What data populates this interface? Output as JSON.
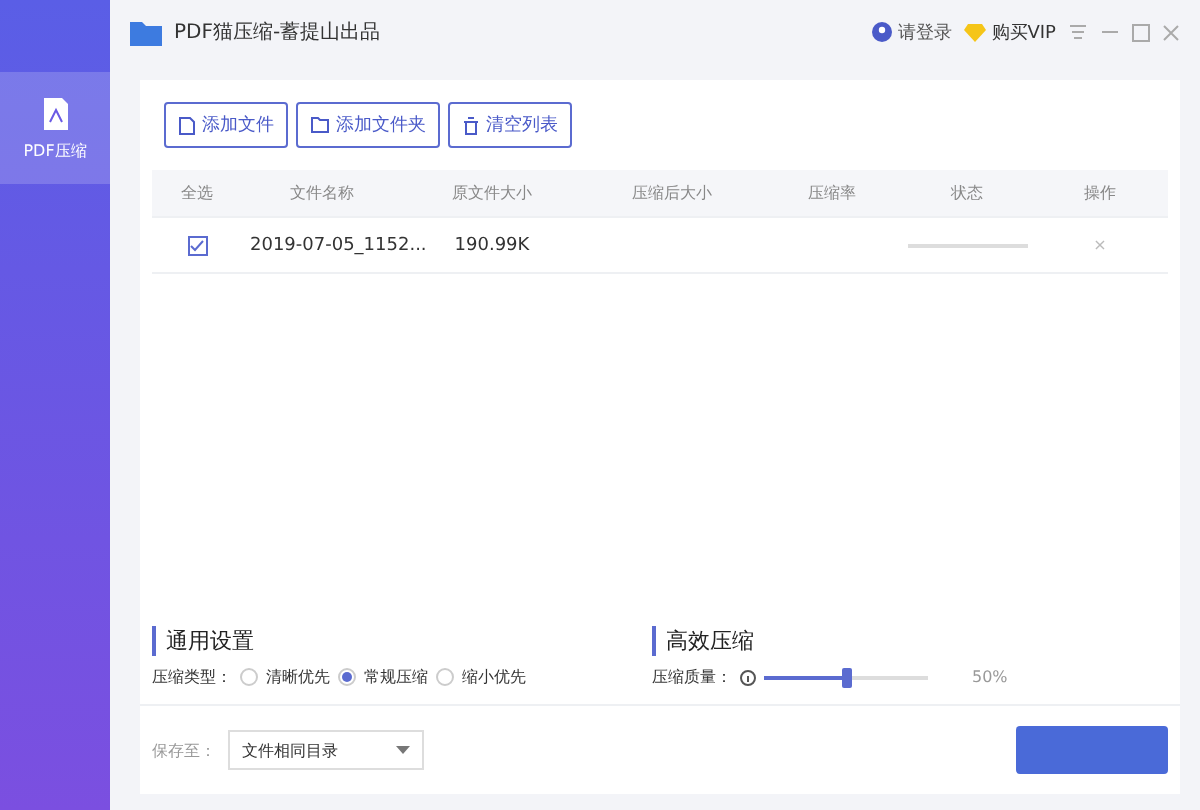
{
  "window": {
    "title": "PDF猫压缩-蓄提山出品",
    "login": "请登录",
    "vip": "购买VIP"
  },
  "sidebar": {
    "items": [
      {
        "label": "PDF压缩",
        "selected": true
      }
    ]
  },
  "toolbar": {
    "buttons": [
      {
        "label": "添加文件",
        "kind": "file"
      },
      {
        "label": "添加文件夹",
        "kind": "folder"
      },
      {
        "label": "清空列表",
        "kind": "clear"
      }
    ]
  },
  "table": {
    "columns": [
      "全选",
      "文件名称",
      "原文件大小",
      "压缩后大小",
      "压缩率",
      "状态",
      "操作"
    ],
    "rows": [
      {
        "checked": true,
        "name": "2019-07-05_1152...",
        "size": "190.99K",
        "level": 0,
        "action": "×"
      }
    ]
  },
  "settings": {
    "general": {
      "title": "通用设置",
      "type_label": "压缩类型：",
      "options": [
        {
          "label": "清晰优先",
          "selected": false
        },
        {
          "label": "常规压缩",
          "selected": true
        },
        {
          "label": "缩小优先",
          "selected": false
        }
      ]
    },
    "efficient": {
      "title": "高效压缩",
      "quality_label": "压缩质量：",
      "level": 0.5,
      "reading": "50%"
    }
  },
  "footer": {
    "save_label": "保存至：",
    "save_value": "文件相同目录"
  }
}
